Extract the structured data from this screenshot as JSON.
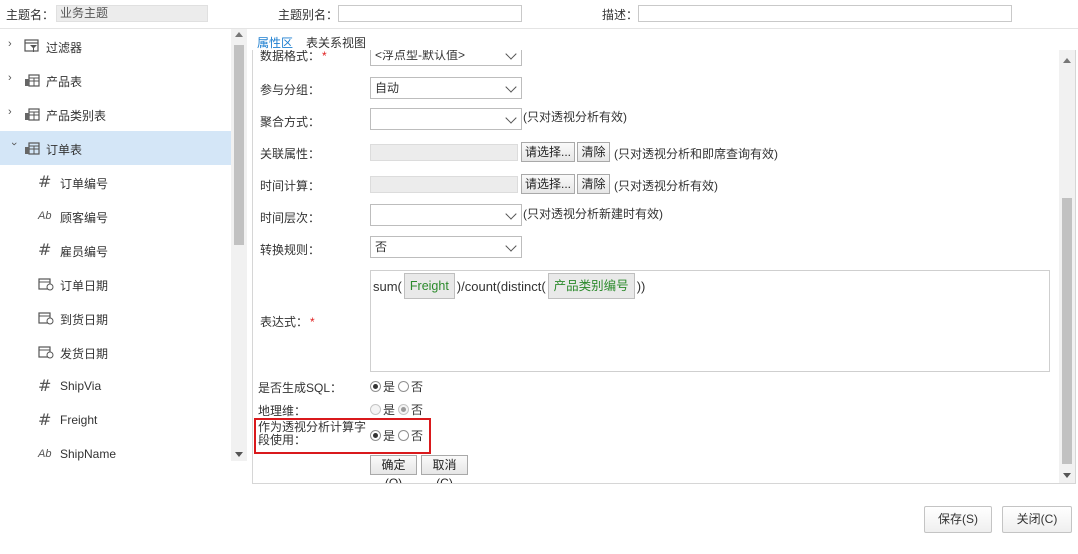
{
  "topbar": {
    "topic_name_label": "主题名：",
    "topic_name_value": "业务主题",
    "alias_label": "主题别名：",
    "alias_value": "",
    "desc_label": "描述：",
    "desc_value": ""
  },
  "tree": {
    "items": [
      {
        "label": "过滤器",
        "icon": "filter-icon"
      },
      {
        "label": "产品表",
        "icon": "table-icon"
      },
      {
        "label": "产品类别表",
        "icon": "table-icon"
      },
      {
        "label": "订单表",
        "icon": "table-icon",
        "selected": true,
        "expanded": true
      },
      {
        "label": "订单编号",
        "icon": "number-field-icon"
      },
      {
        "label": "顾客编号",
        "icon": "text-field-icon"
      },
      {
        "label": "雇员编号",
        "icon": "number-field-icon"
      },
      {
        "label": "订单日期",
        "icon": "date-field-icon"
      },
      {
        "label": "到货日期",
        "icon": "date-field-icon"
      },
      {
        "label": "发货日期",
        "icon": "date-field-icon"
      },
      {
        "label": "ShipVia",
        "icon": "number-field-icon"
      },
      {
        "label": "Freight",
        "icon": "number-field-icon"
      },
      {
        "label": "ShipName",
        "icon": "text-field-icon"
      }
    ]
  },
  "tabs": {
    "props": "属性区",
    "relations": "表关系视图"
  },
  "form": {
    "data_format_label": "数据格式：",
    "data_format_value": "<浮点型-默认值>",
    "grouping_label": "参与分组：",
    "grouping_value": "自动",
    "aggregation_label": "聚合方式：",
    "aggregation_value": "",
    "aggregation_note": "(只对透视分析有效)",
    "related_attr_label": "关联属性：",
    "related_attr_note": "(只对透视分析和即席查询有效)",
    "time_calc_label": "时间计算：",
    "time_calc_note": "(只对透视分析有效)",
    "time_level_label": "时间层次：",
    "time_level_value": "",
    "time_level_note": "(只对透视分析新建时有效)",
    "convert_rule_label": "转换规则：",
    "convert_rule_value": "否",
    "choose_button": "请选择...",
    "clear_button": "清除",
    "expression_label": "表达式：",
    "expression": {
      "part1": "sum(",
      "field1": "Freight",
      "part2": ")/count(distinct(",
      "field2": "产品类别编号",
      "part3": "))"
    },
    "gen_sql_label": "是否生成SQL：",
    "geo_dim_label": "地理维：",
    "pivot_calc_label_1": "作为透视分析计算字",
    "pivot_calc_label_2": "段使用：",
    "yes": "是",
    "no": "否",
    "ok_button": "确定(O)",
    "cancel_button": "取消(C)"
  },
  "footer": {
    "save_button": "保存(S)",
    "close_button": "关闭(C)"
  }
}
